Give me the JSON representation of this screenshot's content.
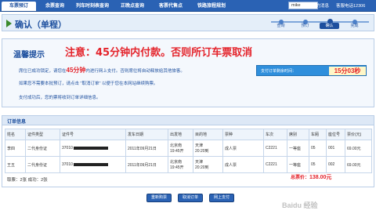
{
  "nav": {
    "tabs": [
      "车票预订",
      "余票查询",
      "列车时刻表查询",
      "正晚点查询",
      "客票代售点",
      "铁路旅程规划"
    ],
    "user_value": "mike",
    "messages_label": "我的消息",
    "phone_label": "客服电话12306"
  },
  "header": {
    "title": "确认（单程）",
    "steps": [
      "查询",
      "预订",
      "确认",
      "完成"
    ],
    "active_step": 2
  },
  "notice": {
    "heading": "温馨提示",
    "overlay_text": "注意：45分钟内付款。否则所订车票取消",
    "line1_prefix": "席位已成功锁定，请您在",
    "line1_highlight": "45分钟",
    "line1_suffix": "内进行网上支付。否则席位将自动释放给其他旅客。",
    "line2": "如果您不需要本批预订，请点击 \"取消订单\" 以便于您在本网站继续购票。",
    "line3": "支付成功后，您的票将收到订单详细信息。",
    "timer_label": "支付订单剩余时间：",
    "timer_value": "15分03秒"
  },
  "order": {
    "caption": "订单信息",
    "columns": [
      "姓名",
      "证件类型",
      "证件号",
      "发车日期",
      "出发地",
      "目的地",
      "票种",
      "车次",
      "席别",
      "车厢",
      "座位号",
      "票价(元)"
    ],
    "rows": [
      {
        "name": "李四",
        "id_type": "二代身份证",
        "id_prefix": "37010",
        "date": "2011年09月21日",
        "from": "北京南",
        "from_time": "19:45开",
        "to": "天津",
        "to_time": "20:20到",
        "ticket": "成人票",
        "train": "C2221",
        "seat_class": "一等座",
        "coach": "05",
        "seat": "001",
        "price": "69.00元"
      },
      {
        "name": "王五",
        "id_type": "二代身份证",
        "id_prefix": "37010",
        "date": "2011年09月21日",
        "from": "北京南",
        "from_time": "19:45开",
        "to": "天津",
        "to_time": "20:20到",
        "ticket": "成人票",
        "train": "C2221",
        "seat_class": "一等座",
        "coach": "05",
        "seat": "002",
        "price": "69.00元"
      }
    ],
    "stats": "取票：2张    成功：2张",
    "total_label": "总票价：",
    "total_value": "138.00元"
  },
  "buttons": {
    "reselect": "重新购票",
    "cancel": "取消订单",
    "pay": "网上支付"
  },
  "watermark": "Baidu 经验"
}
